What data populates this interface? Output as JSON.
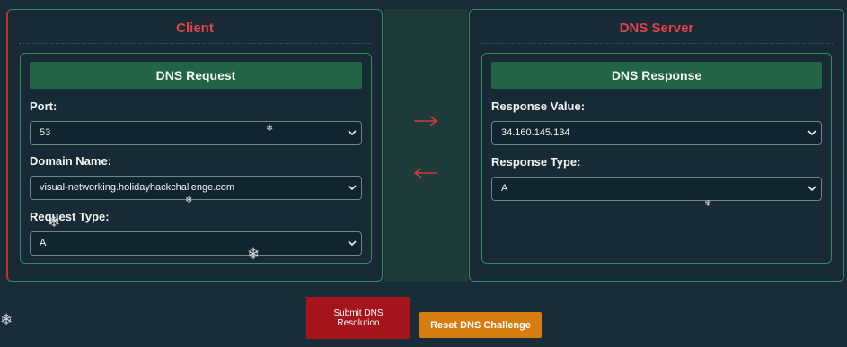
{
  "client": {
    "title": "Client",
    "card_title": "DNS Request",
    "fields": [
      {
        "label": "Port:",
        "value": "53"
      },
      {
        "label": "Domain Name:",
        "value": "visual-networking.holidayhackchallenge.com"
      },
      {
        "label": "Request Type:",
        "value": "A"
      }
    ]
  },
  "server": {
    "title": "DNS Server",
    "card_title": "DNS Response",
    "fields": [
      {
        "label": "Response Value:",
        "value": "34.160.145.134"
      },
      {
        "label": "Response Type:",
        "value": "A"
      }
    ]
  },
  "arrows": {
    "right": "→",
    "left": "←",
    "color": "#d23b3b"
  },
  "buttons": {
    "submit_label": "Submit DNS Resolution",
    "reset_label": "Reset DNS Challenge"
  },
  "decor": {
    "snowflake": "❄"
  },
  "colors": {
    "background": "#182d38",
    "panel_border": "#2f8d5e",
    "title_red": "#e2444a",
    "header_green": "#226443",
    "submit_red": "#a5141b",
    "reset_orange": "#d77c0e"
  }
}
